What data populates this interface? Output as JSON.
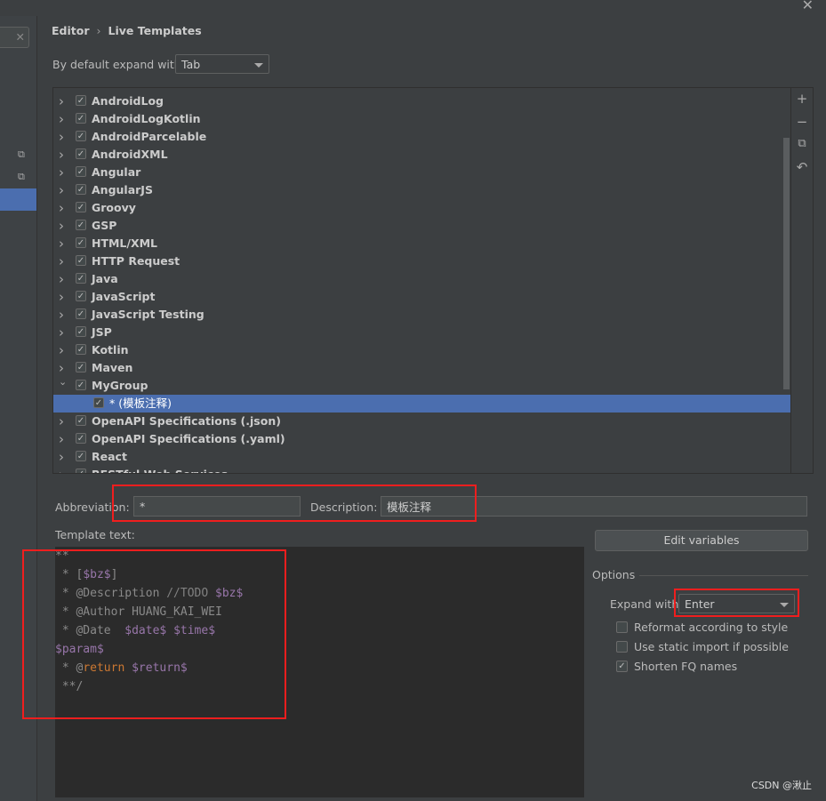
{
  "breadcrumb": {
    "parent": "Editor",
    "separator": "›",
    "current": "Live Templates"
  },
  "default_expand": {
    "label": "By default expand with",
    "value": "Tab"
  },
  "tree": [
    {
      "label": "AndroidLog",
      "checked": true,
      "expanded": false
    },
    {
      "label": "AndroidLogKotlin",
      "checked": true,
      "expanded": false
    },
    {
      "label": "AndroidParcelable",
      "checked": true,
      "expanded": false
    },
    {
      "label": "AndroidXML",
      "checked": true,
      "expanded": false
    },
    {
      "label": "Angular",
      "checked": true,
      "expanded": false
    },
    {
      "label": "AngularJS",
      "checked": true,
      "expanded": false
    },
    {
      "label": "Groovy",
      "checked": true,
      "expanded": false
    },
    {
      "label": "GSP",
      "checked": true,
      "expanded": false
    },
    {
      "label": "HTML/XML",
      "checked": true,
      "expanded": false
    },
    {
      "label": "HTTP Request",
      "checked": true,
      "expanded": false
    },
    {
      "label": "Java",
      "checked": true,
      "expanded": false
    },
    {
      "label": "JavaScript",
      "checked": true,
      "expanded": false
    },
    {
      "label": "JavaScript Testing",
      "checked": true,
      "expanded": false
    },
    {
      "label": "JSP",
      "checked": true,
      "expanded": false
    },
    {
      "label": "Kotlin",
      "checked": true,
      "expanded": false
    },
    {
      "label": "Maven",
      "checked": true,
      "expanded": false
    },
    {
      "label": "MyGroup",
      "checked": true,
      "expanded": true
    },
    {
      "label": "* (模板注释)",
      "checked": true,
      "child": true,
      "selected": true
    },
    {
      "label": "OpenAPI Specifications (.json)",
      "checked": true,
      "expanded": false
    },
    {
      "label": "OpenAPI Specifications (.yaml)",
      "checked": true,
      "expanded": false
    },
    {
      "label": "React",
      "checked": true,
      "expanded": false
    },
    {
      "label": "RESTful Web Services",
      "checked": true,
      "expanded": false
    }
  ],
  "toolbar": {
    "add": "+",
    "remove": "−",
    "copy": "copy-icon",
    "restore": "undo-icon"
  },
  "abbreviation": {
    "label": "Abbreviation:",
    "value": "*"
  },
  "description": {
    "label": "Description:",
    "value": "模板注释"
  },
  "template_text_label": "Template text:",
  "template_lines": [
    [
      {
        "t": "**",
        "c": "dim"
      }
    ],
    [
      {
        "t": " * [",
        "c": "dim"
      },
      {
        "t": "$bz$",
        "c": "var"
      },
      {
        "t": "]",
        "c": "dim"
      }
    ],
    [
      {
        "t": " * @Description ",
        "c": "dim"
      },
      {
        "t": "//TODO ",
        "c": "cm"
      },
      {
        "t": "$bz$",
        "c": "var"
      }
    ],
    [
      {
        "t": " * @Author HUANG_KAI_WEI",
        "c": "dim"
      }
    ],
    [
      {
        "t": " * @Date  ",
        "c": "dim"
      },
      {
        "t": "$date$",
        "c": "var"
      },
      {
        "t": " ",
        "c": "dim"
      },
      {
        "t": "$time$",
        "c": "var"
      }
    ],
    [
      {
        "t": "$param$",
        "c": "var"
      }
    ],
    [
      {
        "t": " * @",
        "c": "dim"
      },
      {
        "t": "return",
        "c": "tag"
      },
      {
        "t": " ",
        "c": "dim"
      },
      {
        "t": "$return$",
        "c": "var"
      }
    ],
    [
      {
        "t": " **/",
        "c": "dim"
      }
    ]
  ],
  "edit_variables": "Edit variables",
  "options": {
    "title": "Options",
    "expand_label": "Expand with",
    "expand_value": "Enter",
    "checks": [
      {
        "label": "Reformat according to style",
        "checked": false
      },
      {
        "label": "Use static import if possible",
        "checked": false
      },
      {
        "label": "Shorten FQ names",
        "checked": true
      }
    ]
  },
  "watermark": "CSDN @湫止",
  "colors": {
    "selection": "#4b6eaf",
    "annotation": "#f01e1e",
    "background": "#3c3f41",
    "editor": "#2b2b2b"
  }
}
